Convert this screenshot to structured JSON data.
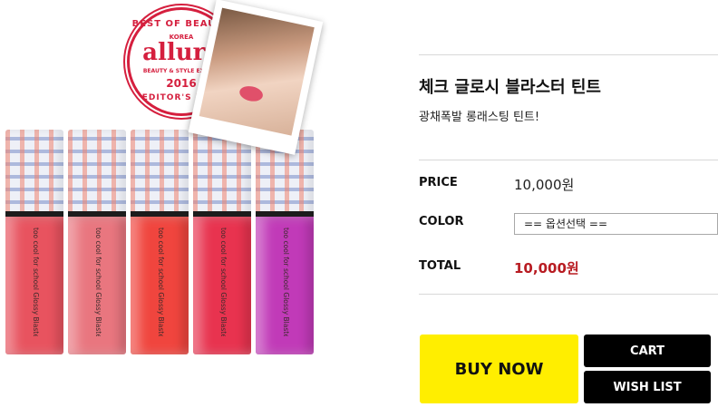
{
  "product_image": {
    "badge": {
      "top_text": "BEST OF BEAUTY",
      "country": "KOREA",
      "brand": "allure",
      "sub_text": "BEAUTY & STYLE EXPERT",
      "year": "2016",
      "bottom_text": "EDITOR'S PICK"
    },
    "tube_label": "too cool for school  Glossy Blaster Tint",
    "tube_colors": [
      "#e8535f",
      "#e9767f",
      "#f0453e",
      "#e8334f",
      "#c13ab8"
    ]
  },
  "product": {
    "title": "체크 글로시 블라스터 틴트",
    "subtitle": "광채폭발 롱래스팅 틴트!"
  },
  "details": {
    "price_label": "PRICE",
    "price_value": "10,000원",
    "color_label": "COLOR",
    "color_select": "== 옵션선택 ==",
    "total_label": "TOTAL",
    "total_value": "10,000원"
  },
  "actions": {
    "buy_now": "BUY NOW",
    "cart": "CART",
    "wish_list": "WISH LIST"
  }
}
